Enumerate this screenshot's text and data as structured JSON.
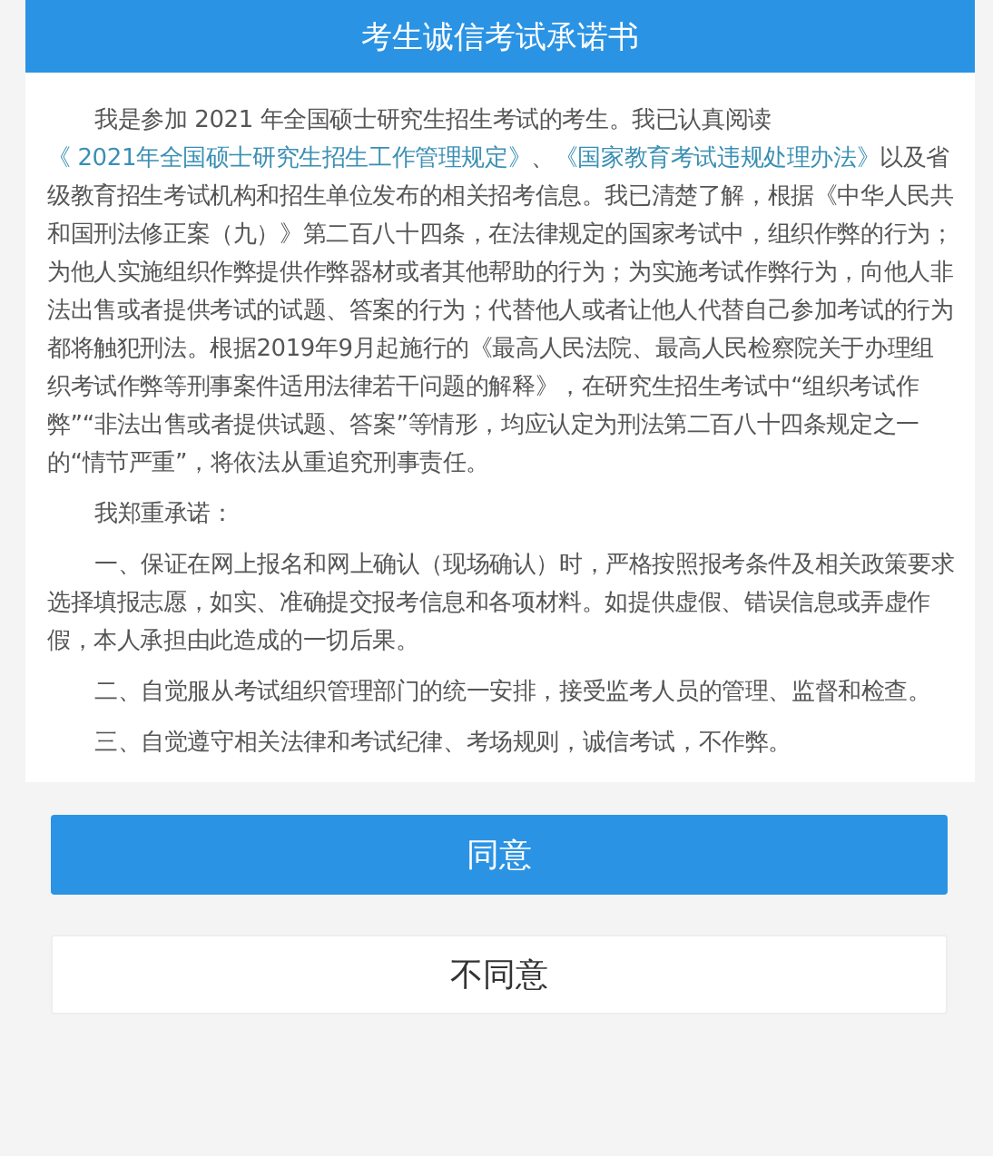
{
  "header": {
    "title": "考生诚信考试承诺书"
  },
  "paragraphs": [
    {
      "segments": [
        {
          "kind": "plain",
          "text": "我是参加 2021 年全国硕士研究生招生考试的考生。我已认真阅读 "
        },
        {
          "kind": "link",
          "text": "《 2021年全国硕士研究生招生工作管理规定》"
        },
        {
          "kind": "plain",
          "text": "、"
        },
        {
          "kind": "link",
          "text": "《国家教育考试违规处理办法》"
        },
        {
          "kind": "plain",
          "text": "以及省级教育招生考试机构和招生单位发布的相关招考信息。我已清楚了解，根据《中华人民共和国刑法修正案（九）》第二百八十四条，在法律规定的国家考试中，组织作弊的行为；为他人实施组织作弊提供作弊器材或者其他帮助的行为；为实施考试作弊行为，向他人非法出售或者提供考试的试题、答案的行为；代替他人或者让他人代替自己参加考试的行为都将触犯刑法。根据2019年9月起施行的《最高人民法院、最高人民检察院关于办理组织考试作弊等刑事案件适用法律若干问题的解释》，在研究生招生考试中“组织考试作弊”“非法出售或者提供试题、答案”等情形，均应认定为刑法第二百八十四条规定之一的“情节严重”，将依法从重追究刑事责任。"
        }
      ]
    },
    {
      "segments": [
        {
          "kind": "plain",
          "text": "我郑重承诺："
        }
      ]
    },
    {
      "segments": [
        {
          "kind": "plain",
          "text": "一、保证在网上报名和网上确认（现场确认）时，严格按照报考条件及相关政策要求选择填报志愿，如实、准确提交报考信息和各项材料。如提供虚假、错误信息或弄虚作假，本人承担由此造成的一切后果。"
        }
      ]
    },
    {
      "segments": [
        {
          "kind": "plain",
          "text": "二、自觉服从考试组织管理部门的统一安排，接受监考人员的管理、监督和检查。"
        }
      ]
    },
    {
      "segments": [
        {
          "kind": "plain",
          "text": "三、自觉遵守相关法律和考试纪律、考场规则，诚信考试，不作弊。"
        }
      ]
    }
  ],
  "buttons": [
    {
      "kind": "primary",
      "label": "同意"
    },
    {
      "kind": "secondary",
      "label": "不同意"
    }
  ]
}
